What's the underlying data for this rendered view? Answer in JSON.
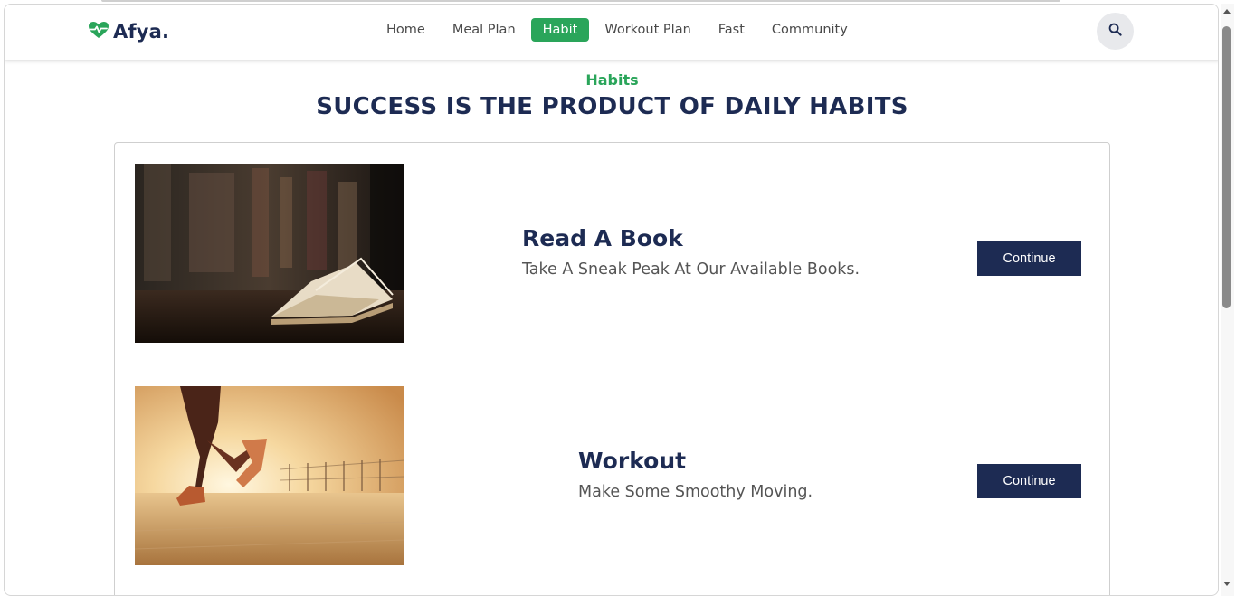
{
  "brand": {
    "name": "Afya.",
    "icon": "heartbeat-icon",
    "color": "#2aa55a"
  },
  "nav": {
    "items": [
      {
        "label": "Home",
        "active": false
      },
      {
        "label": "Meal Plan",
        "active": false
      },
      {
        "label": "Habit",
        "active": true
      },
      {
        "label": "Workout Plan",
        "active": false
      },
      {
        "label": "Fast",
        "active": false
      },
      {
        "label": "Community",
        "active": false
      }
    ],
    "search_icon": "search-icon"
  },
  "section": {
    "kicker": "Habits",
    "title": "SUCCESS IS THE PRODUCT OF DAILY HABITS"
  },
  "habits": [
    {
      "title": "Read A Book",
      "description": "Take A Sneak Peak At Our Available Books.",
      "button": "Continue",
      "image": "open-book-on-table-photo"
    },
    {
      "title": "Workout",
      "description": "Make Some Smoothy Moving.",
      "button": "Continue",
      "image": "runner-at-sunset-photo"
    }
  ],
  "colors": {
    "accent": "#2aa55a",
    "navy": "#1d2b53"
  }
}
